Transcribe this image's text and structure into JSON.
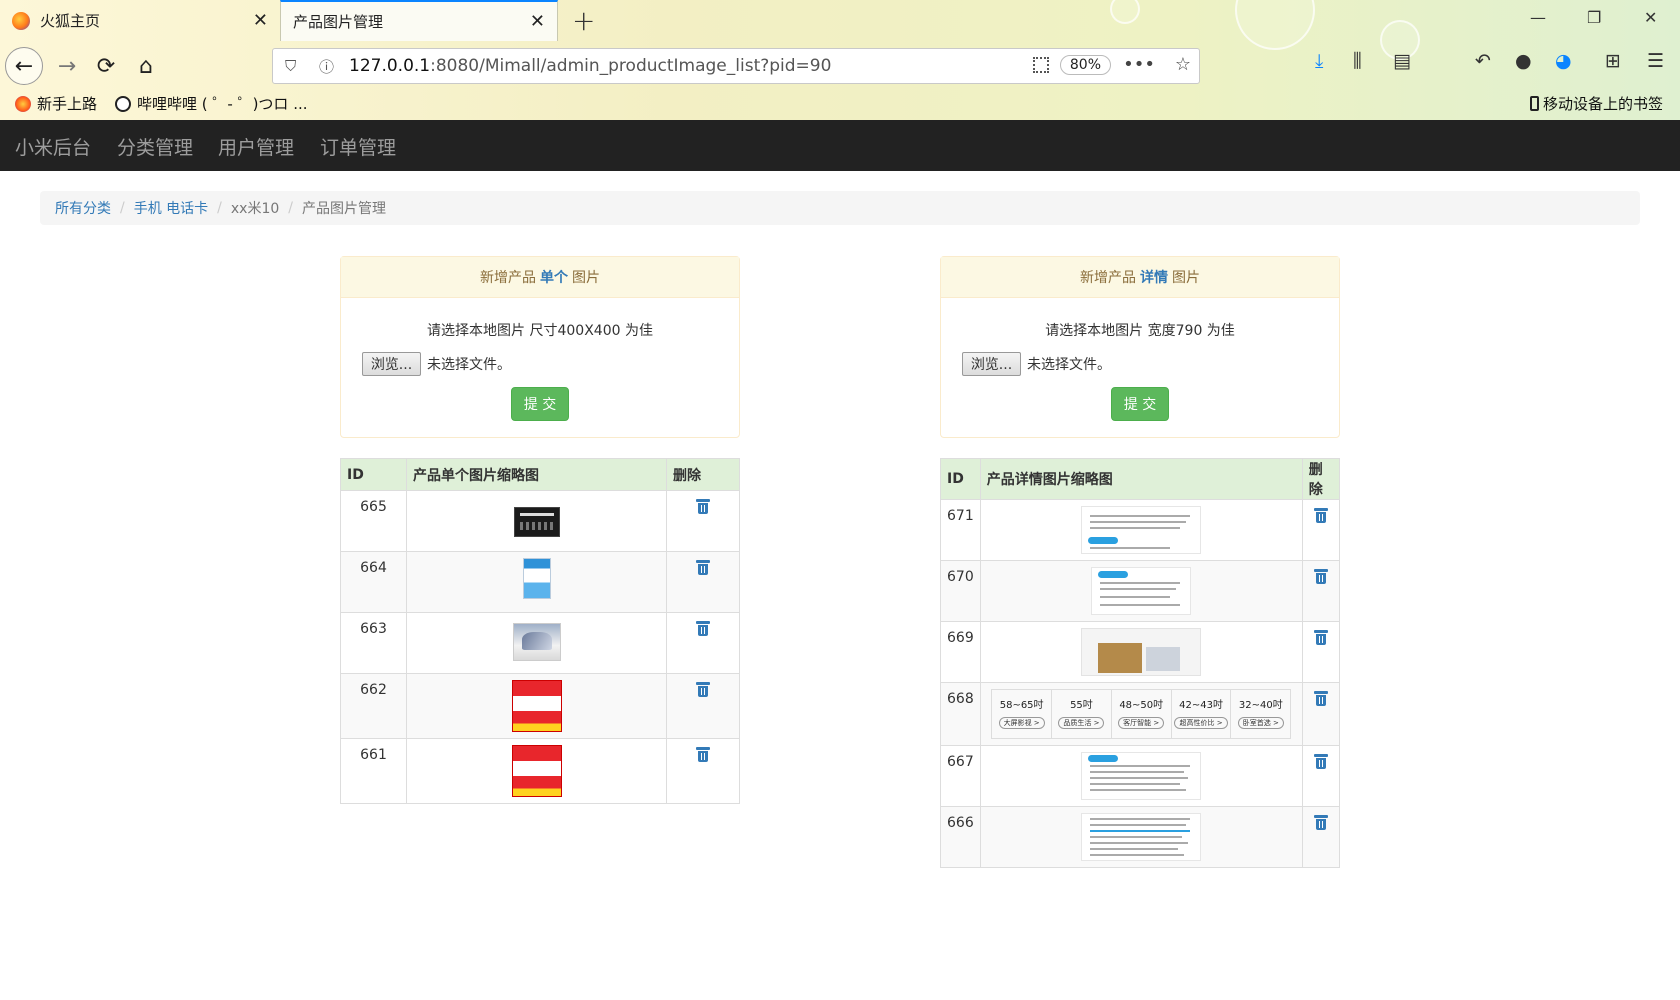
{
  "browser": {
    "tabs": [
      {
        "label": "火狐主页",
        "active": false
      },
      {
        "label": "产品图片管理",
        "active": true
      }
    ],
    "url_host": "127.0.0.1",
    "url_rest": ":8080/Mimall/admin_productImage_list?pid=90",
    "zoom": "80%",
    "bookmarks": [
      {
        "label": "新手上路"
      },
      {
        "label": "哔哩哔哩 ( ゜- ゜)つロ ..."
      }
    ],
    "mobile_bookmarks": "移动设备上的书签"
  },
  "nav": {
    "brand": "小米后台",
    "items": [
      "分类管理",
      "用户管理",
      "订单管理"
    ]
  },
  "breadcrumb": {
    "all": "所有分类",
    "category": "手机 电话卡",
    "product": "xx米10",
    "current": "产品图片管理"
  },
  "single_panel": {
    "title_prefix": "新增产品",
    "title_type": "单个",
    "title_suffix": "图片",
    "hint": "请选择本地图片 尺寸400X400 为佳",
    "browse": "浏览...",
    "no_file": "未选择文件。",
    "submit": "提 交"
  },
  "detail_panel": {
    "title_prefix": "新增产品",
    "title_type": "详情",
    "title_suffix": "图片",
    "hint": "请选择本地图片 宽度790 为佳",
    "browse": "浏览...",
    "no_file": "未选择文件。",
    "submit": "提 交"
  },
  "single_table": {
    "headers": [
      "ID",
      "产品单个图片缩略图",
      "删除"
    ],
    "rows": [
      {
        "id": "665",
        "thumb": "dark-spec-card"
      },
      {
        "id": "664",
        "thumb": "blue-phone-card"
      },
      {
        "id": "663",
        "thumb": "tv-photo"
      },
      {
        "id": "662",
        "thumb": "red-promo-card"
      },
      {
        "id": "661",
        "thumb": "red-promo-card"
      }
    ]
  },
  "detail_table": {
    "headers": [
      "ID",
      "产品详情图片缩略图",
      "删除"
    ],
    "rows": [
      {
        "id": "671",
        "thumb": "text-doc"
      },
      {
        "id": "670",
        "thumb": "text-doc"
      },
      {
        "id": "669",
        "thumb": "box-photo"
      },
      {
        "id": "668",
        "thumb": "size-chart"
      },
      {
        "id": "667",
        "thumb": "text-doc"
      },
      {
        "id": "666",
        "thumb": "text-doc"
      }
    ],
    "size_chart": [
      {
        "size": "58~65吋",
        "tag": "大屏影视 >"
      },
      {
        "size": "55吋",
        "tag": "品质生活 >"
      },
      {
        "size": "48~50吋",
        "tag": "客厅智能 >"
      },
      {
        "size": "42~43吋",
        "tag": "超高性价比 >"
      },
      {
        "size": "32~40吋",
        "tag": "卧室首选 >"
      }
    ]
  },
  "colors": {
    "navbar_bg": "#222222",
    "link": "#337ab7",
    "submit_bg": "#5cb85c",
    "table_header_bg": "#dff0d8",
    "panel_header_bg": "#fcf8e3"
  }
}
